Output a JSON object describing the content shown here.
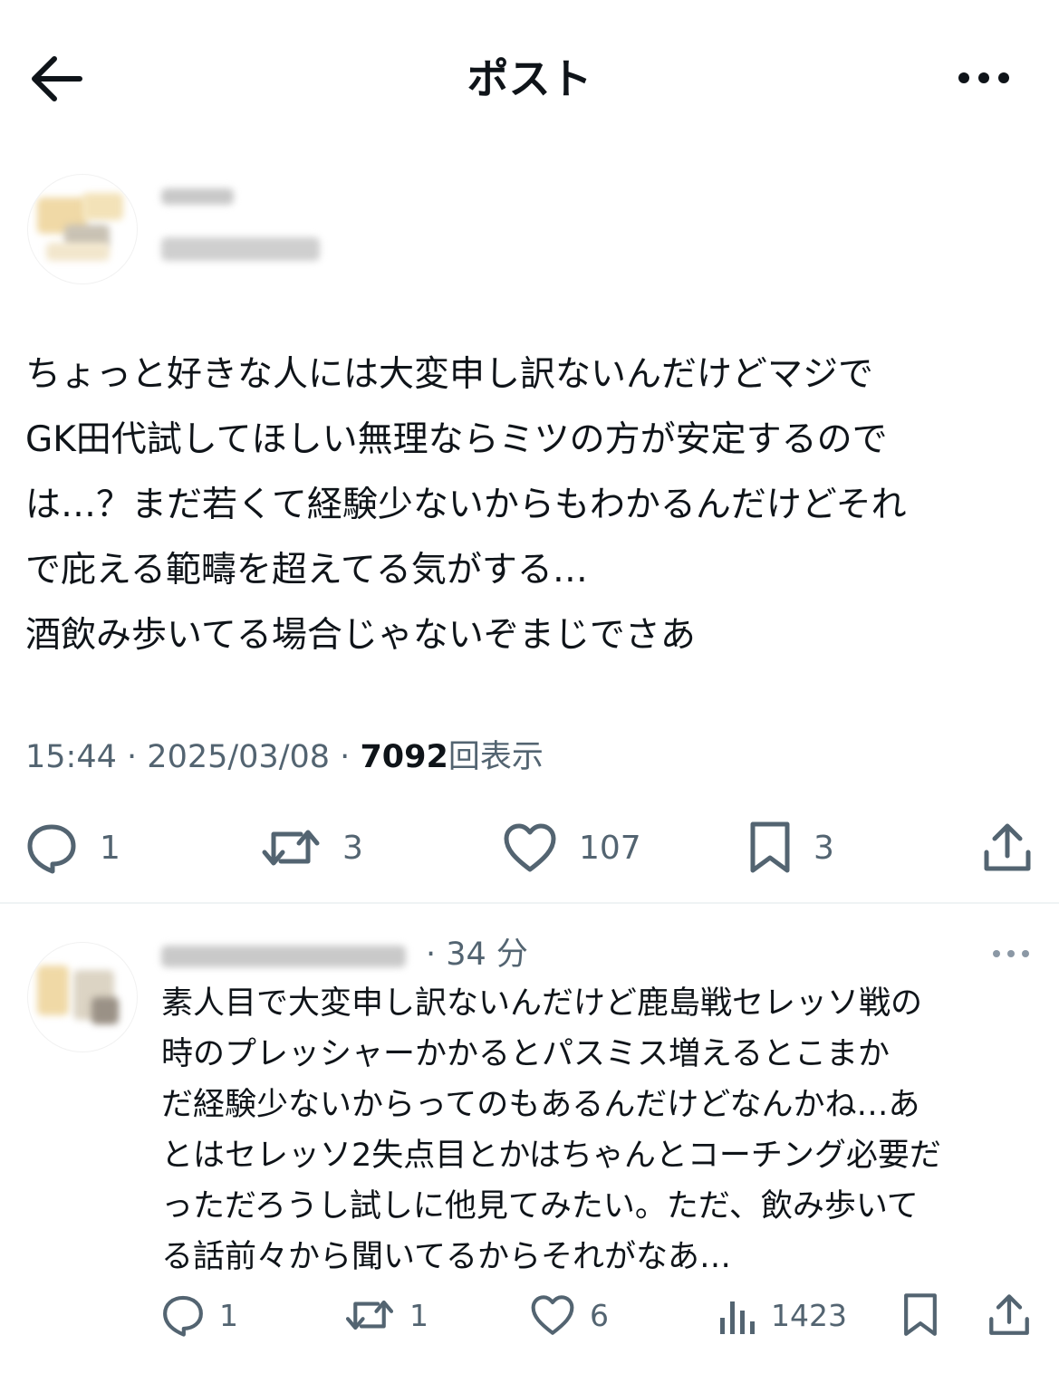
{
  "header": {
    "title": "ポスト",
    "back_icon": "arrow-left-icon",
    "more_icon": "more-horizontal-icon"
  },
  "post": {
    "text": "ちょっと好きな人には大変申し訳ないんだけどマジで\nGK田代試してほしい無理ならミツの方が安定するので\nは…？まだ若くて経験少ないからもわかるんだけどそれ\nで庇える範疇を超えてる気がする…\n酒飲み歩いてる場合じゃないぞまじでさあ",
    "time": "15:44",
    "date": "2025/03/08",
    "sep": "·",
    "views_count": "7092",
    "views_label": "回表示",
    "stats": {
      "replies": "1",
      "reposts": "3",
      "likes": "107",
      "bookmarks": "3"
    }
  },
  "reply": {
    "time": "· 34 分",
    "text": "素人目で大変申し訳ないんだけど鹿島戦セレッソ戦の\n時のプレッシャーかかるとパスミス増えるとこまか\nだ経験少ないからってのもあるんだけどなんかね…あ\nとはセレッソ2失点目とかはちゃんとコーチング必要だ\nっただろうし試しに他見てみたい。ただ、飲み歩いて\nる話前々から聞いてるからそれがなあ…",
    "stats": {
      "replies": "1",
      "reposts": "1",
      "likes": "6",
      "views": "1423"
    }
  },
  "colors": {
    "text": "#0f1419",
    "secondary": "#536471",
    "divider": "#eff3f4"
  }
}
